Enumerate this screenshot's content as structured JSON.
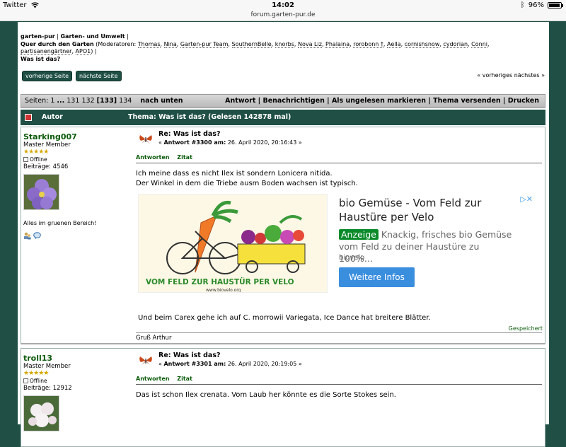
{
  "statusbar": {
    "carrier": "Twitter",
    "time": "14:02",
    "url": "forum.garten-pur.de",
    "battery": "96%",
    "battery_level": 0.96
  },
  "breadcrumb": {
    "site": "garten-pur",
    "board": "Garten- und Umwelt",
    "topic": "Quer durch den Garten",
    "moderators_label": "(Moderatoren:",
    "moderators": [
      "Thomas",
      "Nina",
      "Garten-pur Team",
      "SouthernBelle",
      "knorbs",
      "Nova Liz",
      "Phalaina",
      "rorobonn †",
      "Aella",
      "cornishsnow",
      "cydorian",
      "Conni",
      "partisanengärtner",
      "APO1"
    ],
    "current": "Was ist das?"
  },
  "nav": {
    "prev_page": "vorherige Seite",
    "next_page": "nächste Seite",
    "prev_next_topic": "« vorheriges nächstes »"
  },
  "pagebar": {
    "label": "Seiten: 1",
    "ellipsis": "...",
    "p131": "131",
    "p132": "132",
    "current": "[133]",
    "p134": "134",
    "down": "nach unten",
    "actions": [
      "Antwort",
      "Benachrichtigen",
      "Als ungelesen markieren",
      "Thema versenden",
      "Drucken"
    ]
  },
  "thread": {
    "author_header": "Autor",
    "title": "Thema: Was ist das?  (Gelesen 142878 mal)"
  },
  "posts": [
    {
      "username": "Starking007",
      "rank": "Master Member",
      "stars": "★★★★★",
      "status": "Offline",
      "post_count": "Beiträge: 4546",
      "tagline": "Alles im gruenen Bereich!",
      "subject": "Re: Was ist das?",
      "meta_prefix": "« ",
      "meta_num": "Antwort #3300 am:",
      "meta_date": " 26. April 2020, 20:16:43 »",
      "reply": "Antworten",
      "quote": "Zitat",
      "line1": "Ich meine dass es nicht Ilex ist sondern Lonicera nitida.",
      "line2": "Der Winkel in dem die Triebe ausm Boden wachsen ist typisch.",
      "line3": "Und beim Carex gehe ich auf C. morrowii Variegata, Ice Dance hat breitere Blätter.",
      "saved": "Gespeichert",
      "signature": "Gruß Arthur"
    },
    {
      "username": "troll13",
      "rank": "Master Member",
      "stars": "★★★★★",
      "status": "Offline",
      "post_count": "Beiträge: 12912",
      "subject": "Re: Was ist das?",
      "meta_prefix": "« ",
      "meta_num": "Antwort #3301 am:",
      "meta_date": " 26. April 2020, 20:19:05 »",
      "reply": "Antworten",
      "quote": "Zitat",
      "line1": "Das ist schon Ilex crenata. Vom Laub her könnte es die Sorte Stokes sein."
    }
  ],
  "ad": {
    "title": "bio Gemüse - Vom Feld zur Haustüre per Velo",
    "badge": "Anzeige",
    "text": "Knackig, frisches bio Gemüse vom Feld zu deiner Haustüre zu 100%…",
    "source": "biovelo",
    "cta": "Weitere Infos",
    "close": "▷✕",
    "image_caption": "VOM FELD ZUR HAUSTÜR PER VELO",
    "image_url": "www.biovelo.org"
  },
  "colors": {
    "forum_green": "#1f4f45",
    "username_green": "#0a5a0a",
    "ad_button": "#3a8ede"
  }
}
